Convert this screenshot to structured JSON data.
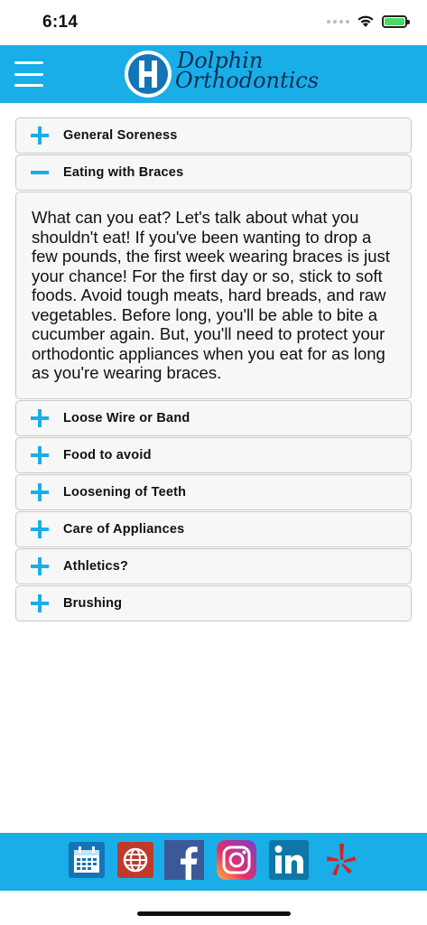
{
  "status_bar": {
    "time": "6:14"
  },
  "header": {
    "logo_line1": "Dolphin",
    "logo_line2": "Orthodontics",
    "brand_color": "#1aaee8"
  },
  "accordion": {
    "items": [
      {
        "label": "General Soreness",
        "expanded": false
      },
      {
        "label": "Eating with Braces",
        "expanded": true
      },
      {
        "label": "Loose Wire or Band",
        "expanded": false
      },
      {
        "label": "Food to avoid",
        "expanded": false
      },
      {
        "label": "Loosening of Teeth",
        "expanded": false
      },
      {
        "label": "Care of Appliances",
        "expanded": false
      },
      {
        "label": "Athletics?",
        "expanded": false
      },
      {
        "label": "Brushing",
        "expanded": false
      }
    ],
    "expanded_content": "What can you eat? Let's talk about what you shouldn't eat! If you've been wanting to drop a few pounds, the first week wearing braces is just your chance! For the first day or so, stick to soft foods. Avoid tough meats, hard breads, and raw vegetables. Before long, you'll be able to bite a cucumber again. But, you'll need to protect your orthodontic appliances when you eat for as long as you're wearing braces."
  },
  "footer": {
    "icons": [
      "calendar-icon",
      "globe-icon",
      "facebook-icon",
      "instagram-icon",
      "linkedin-icon",
      "yelp-icon"
    ]
  }
}
